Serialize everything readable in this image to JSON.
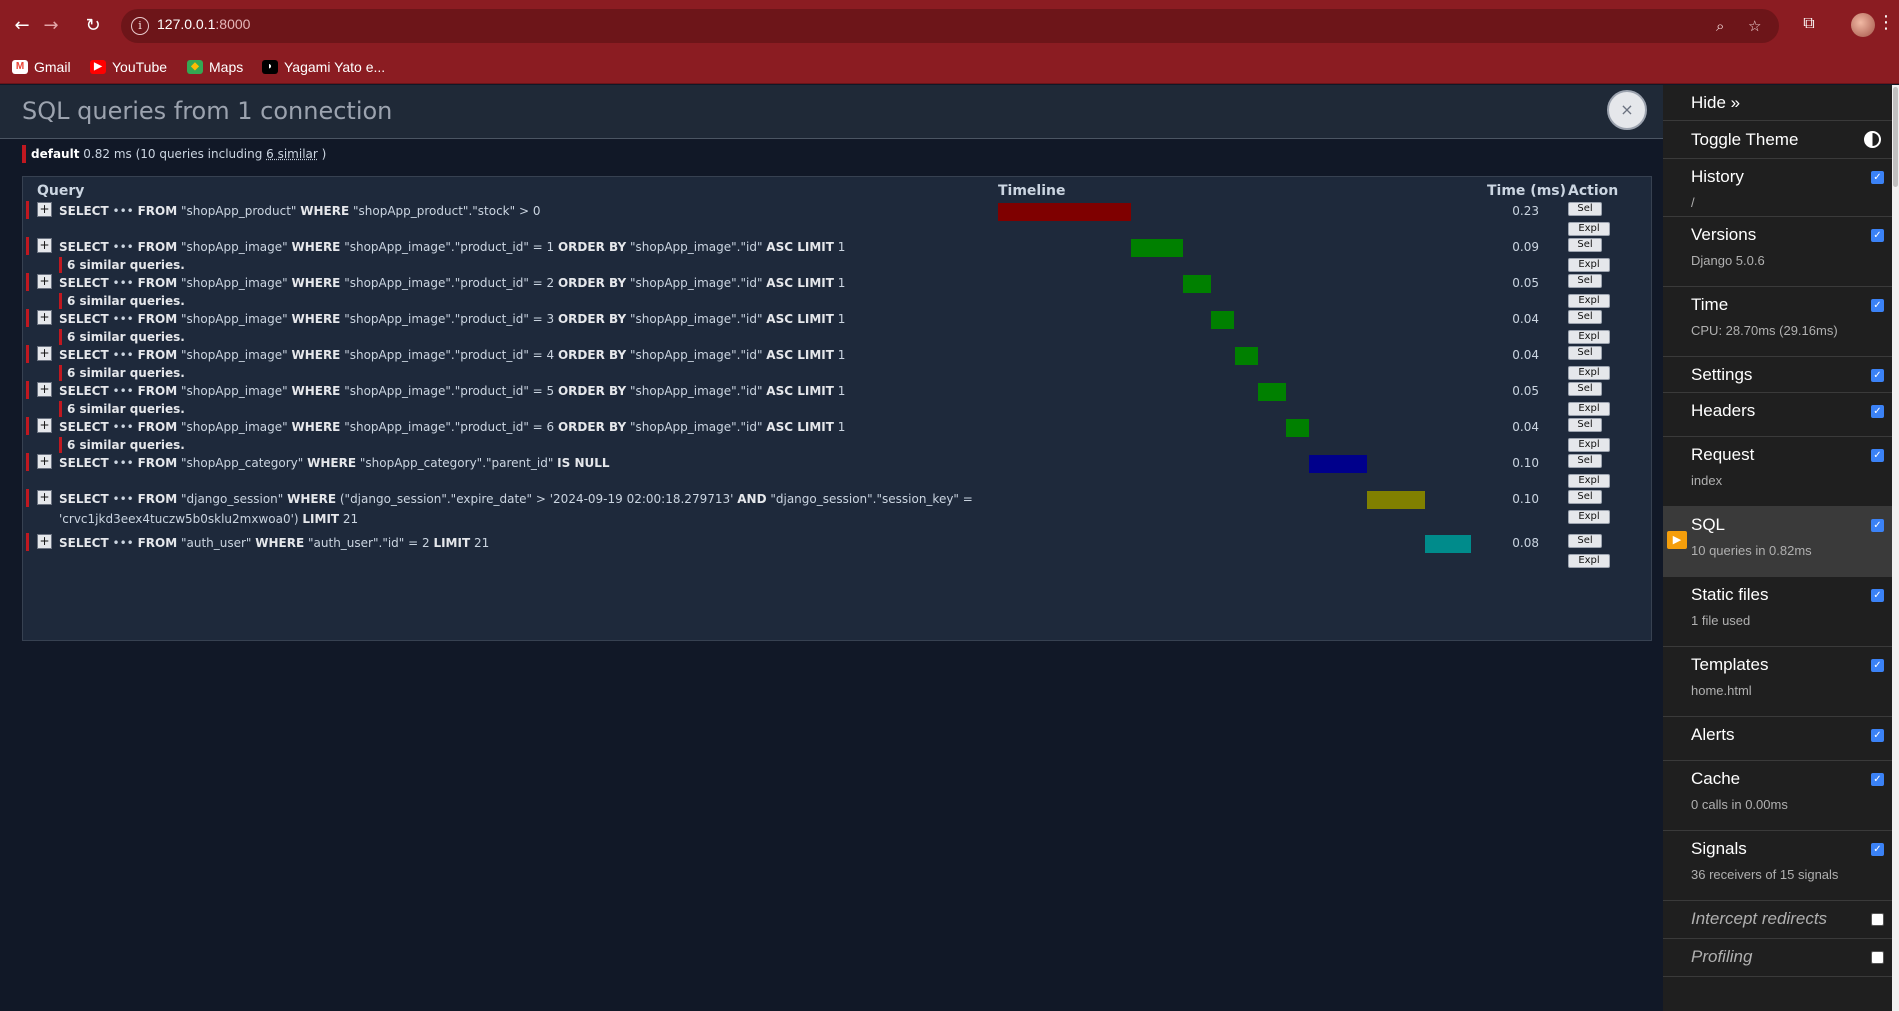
{
  "browser": {
    "url_host": "127.0.0.1",
    "url_port": ":8000",
    "bookmarks": [
      "Gmail",
      "YouTube",
      "Maps",
      "Yagami Yato e..."
    ]
  },
  "panel": {
    "title": "SQL queries from 1 connection",
    "close_label": "×",
    "db_alias": "default",
    "db_summary_pre": "0.82 ms (10 queries including",
    "db_similar": "6 similar",
    "db_summary_post": ")"
  },
  "table": {
    "headers": {
      "query": "Query",
      "timeline": "Timeline",
      "time": "Time (ms)",
      "action": "Action"
    },
    "sel_label": "Sel",
    "expl_label": "Expl",
    "rows": [
      {
        "sql": "<b>SELECT</b> ••• <b>FROM</b> \"shopApp_product\" <b>WHERE</b> \"shopApp_product\".\"stock\" &gt; 0",
        "similar": "",
        "time": "0.23",
        "color": "#7f0000"
      },
      {
        "sql": "<b>SELECT</b> ••• <b>FROM</b> \"shopApp_image\" <b>WHERE</b> \"shopApp_image\".\"product_id\" = 1 <b>ORDER BY</b> \"shopApp_image\".\"id\" <b>ASC LIMIT</b> 1",
        "similar": "6 similar queries.",
        "time": "0.09",
        "color": "#008000"
      },
      {
        "sql": "<b>SELECT</b> ••• <b>FROM</b> \"shopApp_image\" <b>WHERE</b> \"shopApp_image\".\"product_id\" = 2 <b>ORDER BY</b> \"shopApp_image\".\"id\" <b>ASC LIMIT</b> 1",
        "similar": "6 similar queries.",
        "time": "0.05",
        "color": "#008000"
      },
      {
        "sql": "<b>SELECT</b> ••• <b>FROM</b> \"shopApp_image\" <b>WHERE</b> \"shopApp_image\".\"product_id\" = 3 <b>ORDER BY</b> \"shopApp_image\".\"id\" <b>ASC LIMIT</b> 1",
        "similar": "6 similar queries.",
        "time": "0.04",
        "color": "#008000"
      },
      {
        "sql": "<b>SELECT</b> ••• <b>FROM</b> \"shopApp_image\" <b>WHERE</b> \"shopApp_image\".\"product_id\" = 4 <b>ORDER BY</b> \"shopApp_image\".\"id\" <b>ASC LIMIT</b> 1",
        "similar": "6 similar queries.",
        "time": "0.04",
        "color": "#008000"
      },
      {
        "sql": "<b>SELECT</b> ••• <b>FROM</b> \"shopApp_image\" <b>WHERE</b> \"shopApp_image\".\"product_id\" = 5 <b>ORDER BY</b> \"shopApp_image\".\"id\" <b>ASC LIMIT</b> 1",
        "similar": "6 similar queries.",
        "time": "0.05",
        "color": "#008000"
      },
      {
        "sql": "<b>SELECT</b> ••• <b>FROM</b> \"shopApp_image\" <b>WHERE</b> \"shopApp_image\".\"product_id\" = 6 <b>ORDER BY</b> \"shopApp_image\".\"id\" <b>ASC LIMIT</b> 1",
        "similar": "6 similar queries.",
        "time": "0.04",
        "color": "#008000"
      },
      {
        "sql": "<b>SELECT</b> ••• <b>FROM</b> \"shopApp_category\" <b>WHERE</b> \"shopApp_category\".\"parent_id\" <b>IS NULL</b>",
        "similar": "",
        "time": "0.10",
        "color": "#00008b"
      },
      {
        "sql": "<b>SELECT</b> ••• <b>FROM</b> \"django_session\" <b>WHERE</b> (\"django_session\".\"expire_date\" &gt; '2024-09-19 02:00:18.279713' <b>AND</b> \"django_session\".\"session_key\" = 'crvc1jkd3eex4tuczw5b0sklu2mxwoa0') <b>LIMIT</b> 21",
        "similar": "",
        "time": "0.10",
        "color": "#808000"
      },
      {
        "sql": "<b>SELECT</b> ••• <b>FROM</b> \"auth_user\" <b>WHERE</b> \"auth_user\".\"id\" = 2 <b>LIMIT</b> 21",
        "similar": "",
        "time": "0.08",
        "color": "#008b8b"
      }
    ]
  },
  "toolbar": {
    "hide": "Hide »",
    "toggle_theme": "Toggle Theme",
    "items": [
      {
        "label": "History",
        "sub": "/",
        "checked": true
      },
      {
        "label": "Versions",
        "sub": "Django 5.0.6",
        "checked": true
      },
      {
        "label": "Time",
        "sub": "CPU: 28.70ms (29.16ms)",
        "checked": true
      },
      {
        "label": "Settings",
        "sub": "",
        "checked": true
      },
      {
        "label": "Headers",
        "sub": "",
        "checked": true
      },
      {
        "label": "Request",
        "sub": "index",
        "checked": true
      },
      {
        "label": "SQL",
        "sub": "10 queries in 0.82ms",
        "checked": true,
        "active": true
      },
      {
        "label": "Static files",
        "sub": "1 file used",
        "checked": true
      },
      {
        "label": "Templates",
        "sub": "home.html",
        "checked": true
      },
      {
        "label": "Alerts",
        "sub": "",
        "checked": true
      },
      {
        "label": "Cache",
        "sub": "0 calls in 0.00ms",
        "checked": true
      },
      {
        "label": "Signals",
        "sub": "36 receivers of 15 signals",
        "checked": true
      },
      {
        "label": "Intercept redirects",
        "sub": "",
        "checked": false,
        "italic": true
      },
      {
        "label": "Profiling",
        "sub": "",
        "checked": false,
        "italic": true
      }
    ]
  }
}
